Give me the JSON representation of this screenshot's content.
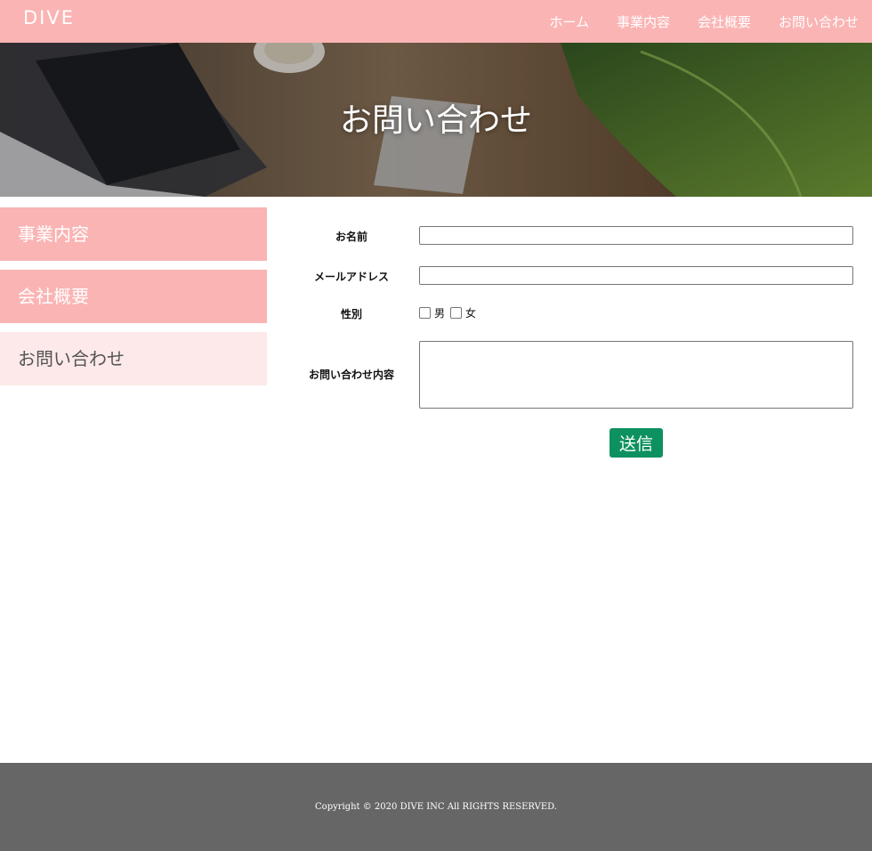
{
  "header": {
    "logo": "DIVE",
    "nav": [
      "ホーム",
      "事業内容",
      "会社概要",
      "お問い合わせ"
    ]
  },
  "hero": {
    "title": "お問い合わせ"
  },
  "sidebar": {
    "items": [
      {
        "label": "事業内容"
      },
      {
        "label": "会社概要"
      },
      {
        "label": "お問い合わせ"
      }
    ]
  },
  "form": {
    "name_label": "お名前",
    "email_label": "メールアドレス",
    "gender_label": "性別",
    "gender_options": [
      "男",
      "女"
    ],
    "message_label": "お問い合わせ内容",
    "submit_label": "送信"
  },
  "footer": {
    "copyright": "Copyright © 2020 DIVE INC All RIGHTS RESERVED."
  },
  "colors": {
    "accent": "#fbb4b4",
    "active_side": "#fde9e9",
    "submit": "#0e9160",
    "footer": "#666666"
  }
}
